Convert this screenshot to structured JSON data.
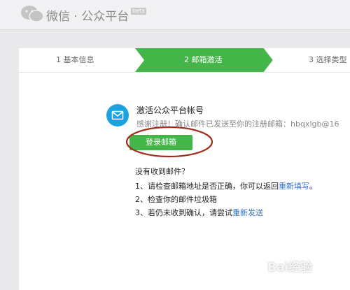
{
  "header": {
    "title": "微信 · 公众平台",
    "badge": "beta"
  },
  "steps": [
    {
      "label": "1 基本信息",
      "active": false
    },
    {
      "label": "2 邮箱激活",
      "active": true
    },
    {
      "label": "3 选择类型",
      "active": false
    }
  ],
  "activation": {
    "title": "激活公众平台帐号",
    "subtitle": "感谢注册！确认邮件已发送至你的注册邮箱：hbqxlgb@16",
    "login_button": "登录邮箱"
  },
  "help": {
    "heading": "没有收到邮件？",
    "tip1_prefix": "1、请检查邮箱地址是否正确，你可以返回",
    "tip1_link": "重新填写",
    "tip1_suffix": "。",
    "tip2": "2、检查你的邮件垃圾箱",
    "tip3_prefix": "3、若仍未收到确认，请尝试",
    "tip3_link": "重新发送"
  },
  "watermark": "Bai经验",
  "colors": {
    "accent": "#44b549",
    "link": "#2f73c8",
    "annotation_circle": "#a0301e"
  }
}
